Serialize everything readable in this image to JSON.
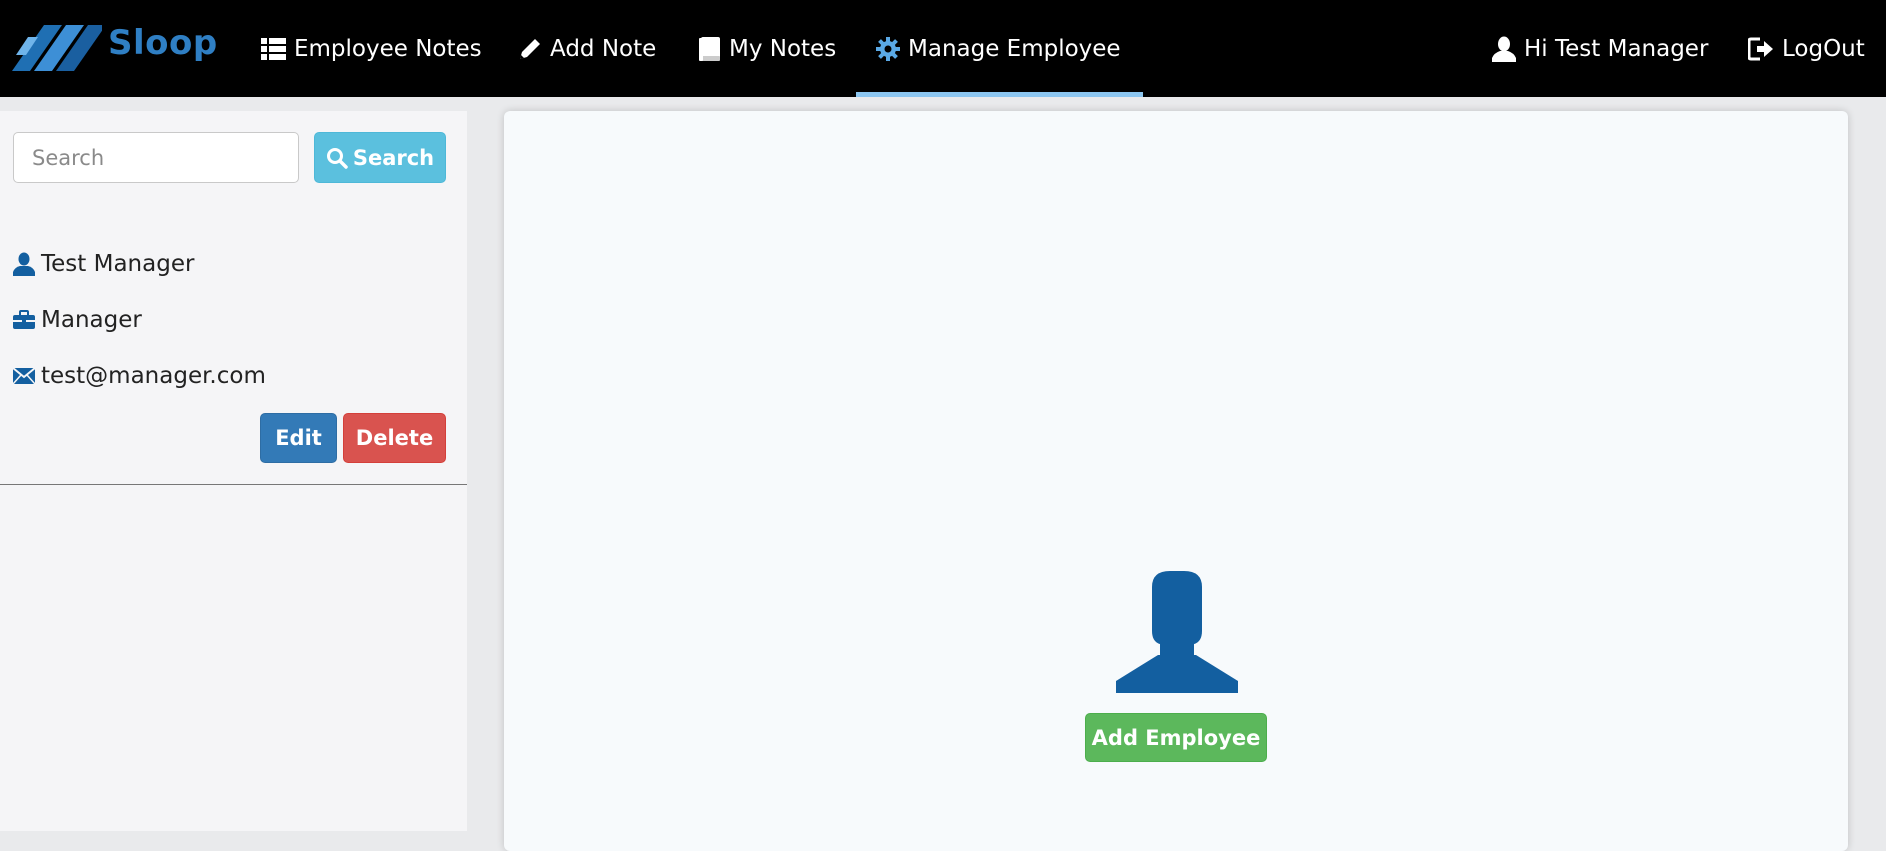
{
  "navbar": {
    "brand": "Sloop",
    "links": [
      {
        "label": "Employee Notes",
        "icon": "list-icon"
      },
      {
        "label": "Add Note",
        "icon": "pencil-icon"
      },
      {
        "label": "My Notes",
        "icon": "book-icon"
      },
      {
        "label": "Manage Employee",
        "icon": "gear-icon",
        "active": true
      }
    ],
    "greeting": "Hi Test Manager",
    "logout": "LogOut"
  },
  "sidebar": {
    "search": {
      "placeholder": "Search",
      "value": "",
      "button_label": "Search"
    },
    "profile": {
      "name": "Test Manager",
      "role": "Manager",
      "email": "test@manager.com"
    },
    "edit_label": "Edit",
    "delete_label": "Delete"
  },
  "main": {
    "add_employee_label": "Add Employee"
  },
  "colors": {
    "navbar_bg": "#000000",
    "brand": "#2f7fc4",
    "active_underline": "#8cc6f0",
    "icon_blue": "#135fa0",
    "search_btn": "#5bc0de",
    "edit_btn": "#337ab7",
    "delete_btn": "#d9534f",
    "add_btn": "#5cb85c"
  }
}
